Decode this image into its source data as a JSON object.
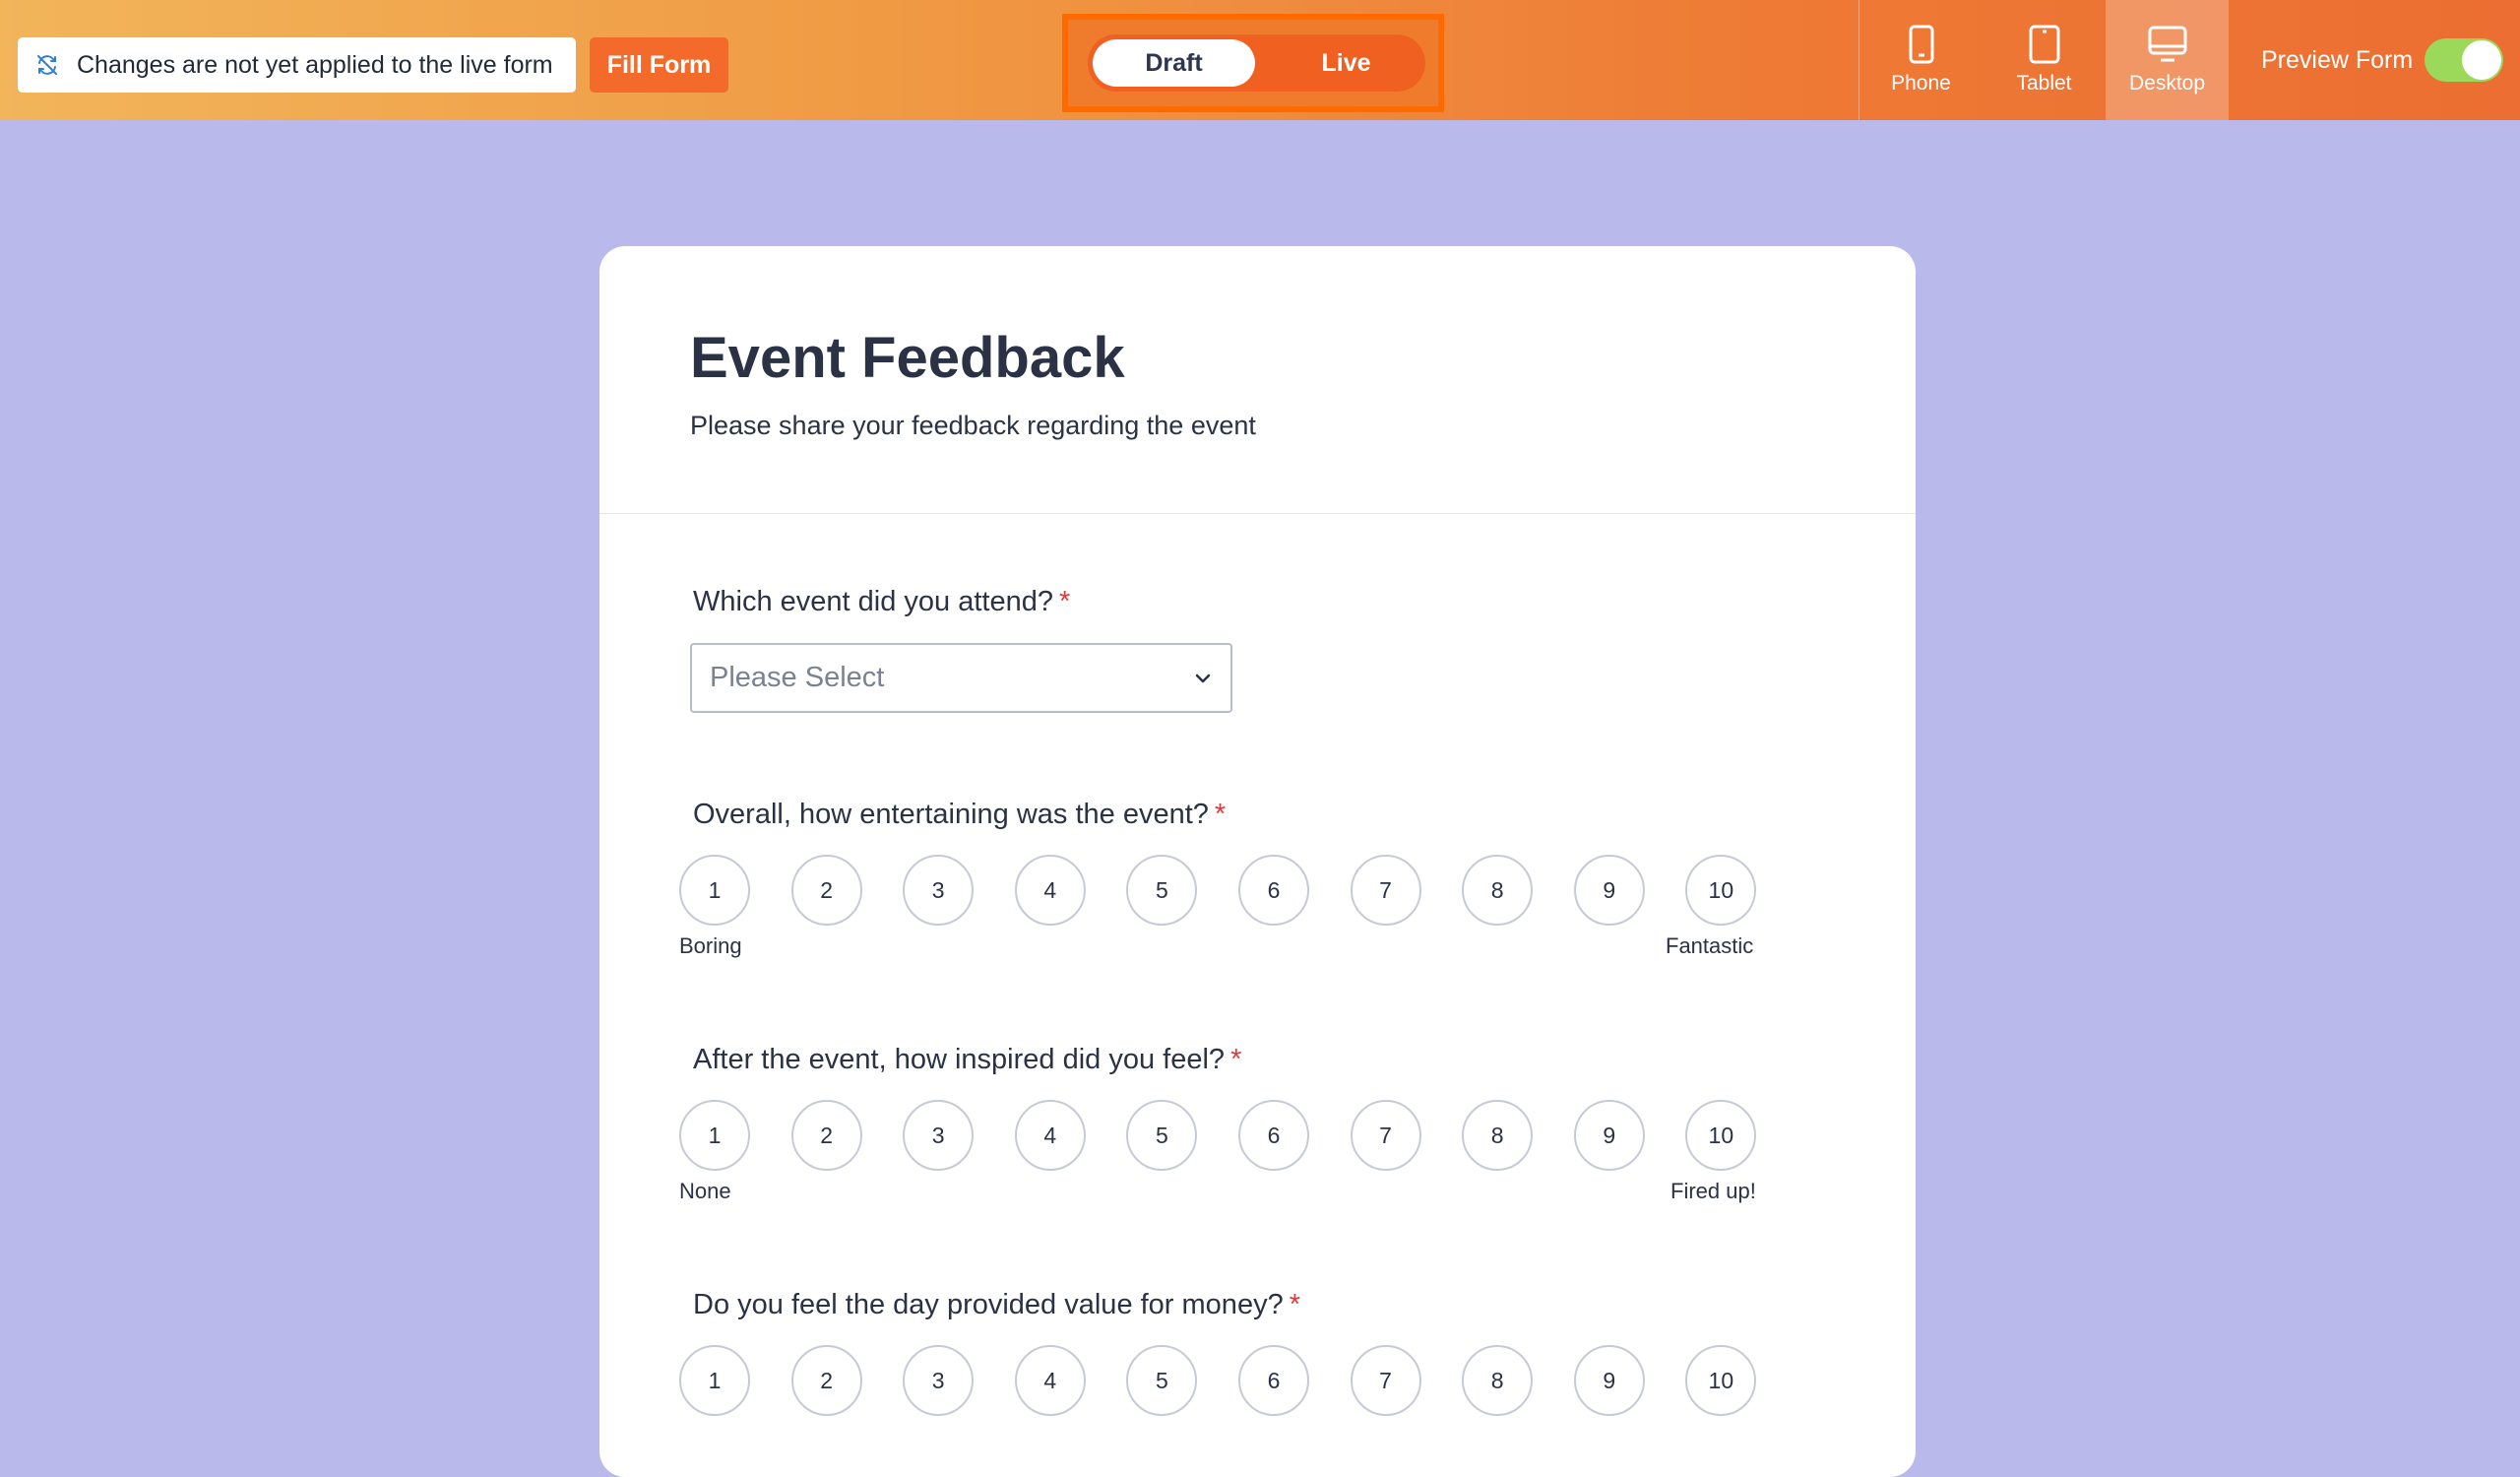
{
  "topbar": {
    "notice_text": "Changes are not yet applied to the live form",
    "notice_icon": "sync-off-icon",
    "fill_form_label": "Fill Form",
    "mode_toggle": {
      "draft_label": "Draft",
      "live_label": "Live",
      "selected": "Draft"
    },
    "devices": [
      {
        "label": "Phone",
        "icon": "phone-icon",
        "active": false
      },
      {
        "label": "Tablet",
        "icon": "tablet-icon",
        "active": false
      },
      {
        "label": "Desktop",
        "icon": "desktop-icon",
        "active": true
      }
    ],
    "preview_label": "Preview Form",
    "preview_enabled": true
  },
  "form": {
    "title": "Event Feedback",
    "subtitle": "Please share your feedback regarding the event",
    "q1": {
      "label": "Which event did you attend?",
      "required_mark": "*",
      "placeholder": "Please Select"
    },
    "q2": {
      "label": "Overall, how entertaining was the event?",
      "required_mark": "*",
      "min_label": "Boring",
      "max_label": "Fantastic"
    },
    "q3": {
      "label": "After the event, how inspired did you feel?",
      "required_mark": "*",
      "min_label": "None",
      "max_label": "Fired up!"
    },
    "q4": {
      "label": "Do you feel the day provided value for money?",
      "required_mark": "*"
    },
    "scale_options": [
      "1",
      "2",
      "3",
      "4",
      "5",
      "6",
      "7",
      "8",
      "9",
      "10"
    ]
  },
  "colors": {
    "accent": "#f46a2b",
    "background": "#b9b9ec",
    "required": "#e03b3b",
    "toggle_on": "#9cd85a"
  }
}
